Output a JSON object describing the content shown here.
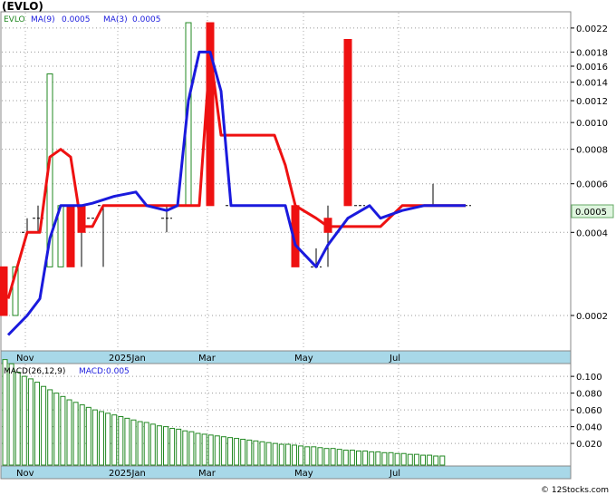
{
  "title": "(EVLO)",
  "credit": "© 12Stocks.com",
  "colors": {
    "up": "#228822",
    "down": "#ee1111",
    "ma_fast": "#1a1add",
    "ma_slow": "#ee1111",
    "axis_band": "#a8d8e8",
    "last_price_bg": "#dff5df",
    "last_price_text": "#008800"
  },
  "chart_data": [
    {
      "type": "candlestick",
      "panel": "price",
      "ticker_label": "EVLO",
      "ma_labels": [
        "MA(9)",
        "0.0005",
        "MA(3)",
        "0.0005"
      ],
      "y_scale": "log",
      "ylim": [
        0.00015,
        0.0025
      ],
      "y_ticks": [
        "0.0002",
        "0.0004",
        "0.0006",
        "0.0008",
        "0.0010",
        "0.0012",
        "0.0014",
        "0.0016",
        "0.0018",
        "0.0022"
      ],
      "last_price": "0.0005",
      "x_labels": [
        "Nov",
        "2025Jan",
        "Mar",
        "May",
        "Jul"
      ],
      "candles": [
        {
          "day": 2,
          "open": 0.0003,
          "close": 0.0002,
          "high": 0.0003,
          "low": 0.0002
        },
        {
          "day": 15,
          "open": 0.0002,
          "close": 0.0003,
          "high": 0.0003,
          "low": 0.0002
        },
        {
          "day": 28,
          "open": 0.0004,
          "close": 0.0004,
          "high": 0.00045,
          "low": 0.0004
        },
        {
          "day": 40,
          "open": 0.00045,
          "close": 0.00045,
          "high": 0.0005,
          "low": 0.0004
        },
        {
          "day": 53,
          "open": 0.0003,
          "close": 0.0015,
          "high": 0.0015,
          "low": 0.0003
        },
        {
          "day": 65,
          "open": 0.0003,
          "close": 0.0005,
          "high": 0.0005,
          "low": 0.0003
        },
        {
          "day": 76,
          "open": 0.0005,
          "close": 0.0003,
          "high": 0.0005,
          "low": 0.0003
        },
        {
          "day": 88,
          "open": 0.0005,
          "close": 0.0004,
          "high": 0.0005,
          "low": 0.0003
        },
        {
          "day": 100,
          "open": 0.00045,
          "close": 0.00045,
          "high": 0.00045,
          "low": 0.00045
        },
        {
          "day": 112,
          "open": 0.0005,
          "close": 0.0005,
          "high": 0.0005,
          "low": 0.0003
        },
        {
          "day": 182,
          "open": 0.00045,
          "close": 0.00045,
          "high": 0.0005,
          "low": 0.0004
        },
        {
          "day": 206,
          "open": 0.0005,
          "close": 0.0023,
          "high": 0.0023,
          "low": 0.0005
        },
        {
          "day": 230,
          "open": 0.0023,
          "close": 0.0005,
          "high": 0.0023,
          "low": 0.0005
        },
        {
          "day": 253,
          "open": 0.0005,
          "close": 0.0005,
          "high": 0.0005,
          "low": 0.0005
        },
        {
          "day": 324,
          "open": 0.0005,
          "close": 0.0003,
          "high": 0.0005,
          "low": 0.0003
        },
        {
          "day": 347,
          "open": 0.0003,
          "close": 0.0003,
          "high": 0.00035,
          "low": 0.0003
        },
        {
          "day": 360,
          "open": 0.00045,
          "close": 0.0004,
          "high": 0.0005,
          "low": 0.0003
        },
        {
          "day": 382,
          "open": 0.002,
          "close": 0.0005,
          "high": 0.002,
          "low": 0.0005
        },
        {
          "day": 395,
          "open": 0.0005,
          "close": 0.0005,
          "high": 0.0005,
          "low": 0.0005
        },
        {
          "day": 476,
          "open": 0.0005,
          "close": 0.0005,
          "high": 0.0006,
          "low": 0.0005
        },
        {
          "day": 512,
          "open": 0.0005,
          "close": 0.0005,
          "high": 0.0005,
          "low": 0.0005
        }
      ],
      "ma_fast": {
        "name": "MA(9)",
        "points": [
          [
            7,
            0.00017
          ],
          [
            28,
            0.0002
          ],
          [
            42,
            0.00023
          ],
          [
            53,
            0.00038
          ],
          [
            65,
            0.0005
          ],
          [
            88,
            0.0005
          ],
          [
            100,
            0.00051
          ],
          [
            124,
            0.00054
          ],
          [
            148,
            0.00056
          ],
          [
            160,
            0.0005
          ],
          [
            182,
            0.00048
          ],
          [
            194,
            0.0005
          ],
          [
            206,
            0.0012
          ],
          [
            218,
            0.0018
          ],
          [
            230,
            0.0018
          ],
          [
            242,
            0.0013
          ],
          [
            253,
            0.0005
          ],
          [
            313,
            0.0005
          ],
          [
            324,
            0.00036
          ],
          [
            347,
            0.0003
          ],
          [
            360,
            0.00036
          ],
          [
            382,
            0.00045
          ],
          [
            406,
            0.0005
          ],
          [
            418,
            0.00045
          ],
          [
            442,
            0.00048
          ],
          [
            466,
            0.0005
          ],
          [
            512,
            0.0005
          ]
        ]
      },
      "ma_slow": {
        "name": "MA(3)",
        "points": [
          [
            7,
            0.00023
          ],
          [
            28,
            0.0004
          ],
          [
            42,
            0.0004
          ],
          [
            53,
            0.00075
          ],
          [
            65,
            0.0008
          ],
          [
            76,
            0.00075
          ],
          [
            88,
            0.00042
          ],
          [
            100,
            0.00042
          ],
          [
            112,
            0.0005
          ],
          [
            124,
            0.0005
          ],
          [
            160,
            0.0005
          ],
          [
            194,
            0.0005
          ],
          [
            218,
            0.0005
          ],
          [
            230,
            0.0018
          ],
          [
            242,
            0.0009
          ],
          [
            253,
            0.0009
          ],
          [
            301,
            0.0009
          ],
          [
            313,
            0.0007
          ],
          [
            324,
            0.0005
          ],
          [
            347,
            0.00045
          ],
          [
            360,
            0.00042
          ],
          [
            382,
            0.00042
          ],
          [
            418,
            0.00042
          ],
          [
            442,
            0.0005
          ],
          [
            512,
            0.0005
          ]
        ]
      }
    },
    {
      "type": "bar",
      "panel": "macd",
      "title_parts": [
        "MACD(26,12,9)",
        "MACD:0.005"
      ],
      "ylim": [
        0.005,
        0.125
      ],
      "y_ticks": [
        "0.100",
        "0.080",
        "0.060",
        "0.040",
        "0.020"
      ],
      "x_labels": [
        "Nov",
        "2025Jan",
        "Mar",
        "May",
        "Jul"
      ],
      "values": [
        0.12,
        0.115,
        0.105,
        0.1,
        0.097,
        0.093,
        0.088,
        0.084,
        0.08,
        0.076,
        0.072,
        0.069,
        0.066,
        0.063,
        0.06,
        0.058,
        0.056,
        0.054,
        0.052,
        0.05,
        0.048,
        0.046,
        0.045,
        0.043,
        0.041,
        0.04,
        0.038,
        0.037,
        0.035,
        0.034,
        0.032,
        0.031,
        0.03,
        0.029,
        0.028,
        0.027,
        0.026,
        0.025,
        0.024,
        0.023,
        0.022,
        0.021,
        0.02,
        0.019,
        0.019,
        0.018,
        0.017,
        0.016,
        0.016,
        0.015,
        0.014,
        0.014,
        0.013,
        0.012,
        0.012,
        0.011,
        0.011,
        0.01,
        0.01,
        0.009,
        0.009,
        0.008,
        0.008,
        0.007,
        0.007,
        0.006,
        0.006,
        0.005,
        0.005
      ]
    }
  ]
}
